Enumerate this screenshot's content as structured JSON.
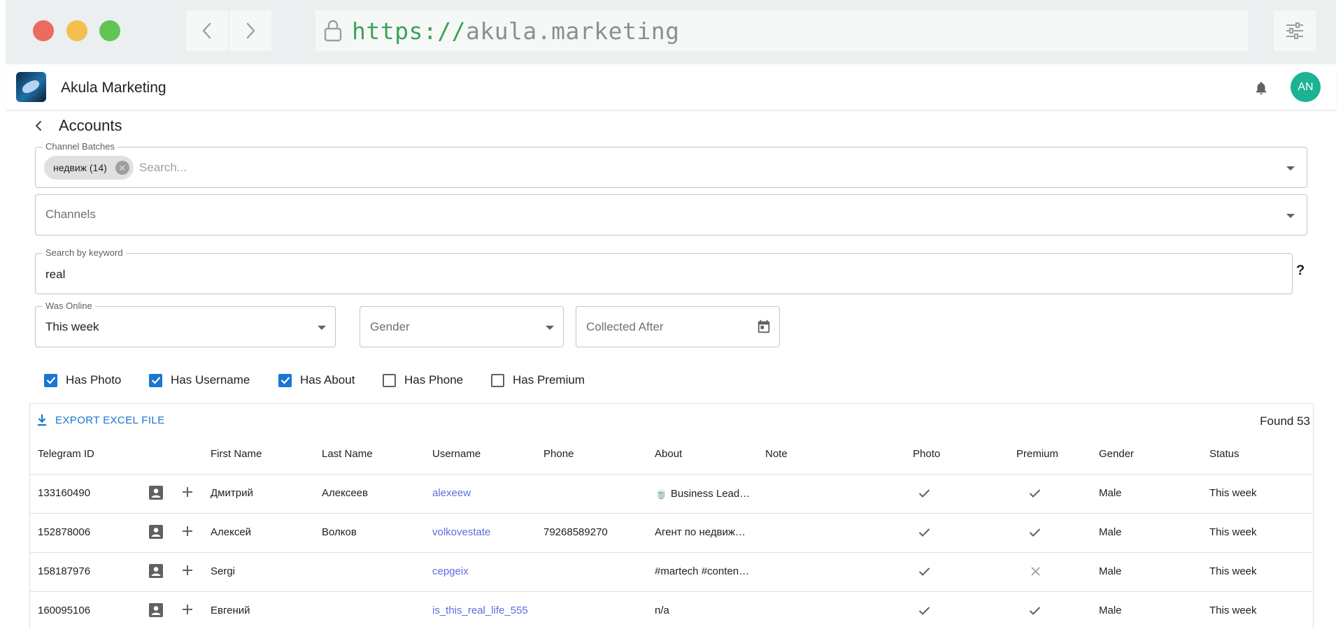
{
  "browser": {
    "url_protocol": "https://",
    "url_host": "akula.marketing"
  },
  "app": {
    "title": "Akula Marketing",
    "avatar_initials": "AN",
    "accent": "#1976d2",
    "avatar_color": "#1cb394"
  },
  "page": {
    "title": "Accounts"
  },
  "filters": {
    "channel_batches": {
      "label": "Channel Batches",
      "chip": "недвиж (14)",
      "placeholder": "Search..."
    },
    "channels": {
      "placeholder": "Channels"
    },
    "keyword": {
      "label": "Search by keyword",
      "value": "real",
      "help": "?"
    },
    "was_online": {
      "label": "Was Online",
      "value": "This week"
    },
    "gender": {
      "placeholder": "Gender"
    },
    "collected_after": {
      "placeholder": "Collected After"
    },
    "checkboxes": [
      {
        "label": "Has Photo",
        "checked": true
      },
      {
        "label": "Has Username",
        "checked": true
      },
      {
        "label": "Has About",
        "checked": true
      },
      {
        "label": "Has Phone",
        "checked": false
      },
      {
        "label": "Has Premium",
        "checked": false
      }
    ]
  },
  "table": {
    "export_label": "EXPORT EXCEL FILE",
    "found": "Found 53",
    "columns": [
      "Telegram ID",
      "First Name",
      "Last Name",
      "Username",
      "Phone",
      "About",
      "Note",
      "Photo",
      "Premium",
      "Gender",
      "Status"
    ],
    "rows": [
      {
        "id": "133160490",
        "first": "Дмитрий",
        "last": "Алексеев",
        "username": "alexeew",
        "phone": "",
        "about": "🍵 Business Lead…",
        "note": "",
        "photo": true,
        "premium": true,
        "gender": "Male",
        "status": "This week"
      },
      {
        "id": "152878006",
        "first": "Алексей",
        "last": "Волков",
        "username": "volkovestate",
        "phone": "79268589270",
        "about": "Агент по недвиж…",
        "note": "",
        "photo": true,
        "premium": true,
        "gender": "Male",
        "status": "This week"
      },
      {
        "id": "158187976",
        "first": "Sergi",
        "last": "",
        "username": "cepgeix",
        "phone": "",
        "about": "#martech #conten…",
        "note": "",
        "photo": true,
        "premium": false,
        "gender": "Male",
        "status": "This week"
      },
      {
        "id": "160095106",
        "first": "Евгений",
        "last": "",
        "username": "is_this_real_life_555",
        "phone": "",
        "about": "n/a",
        "note": "",
        "photo": true,
        "premium": true,
        "gender": "Male",
        "status": "This week"
      }
    ]
  }
}
